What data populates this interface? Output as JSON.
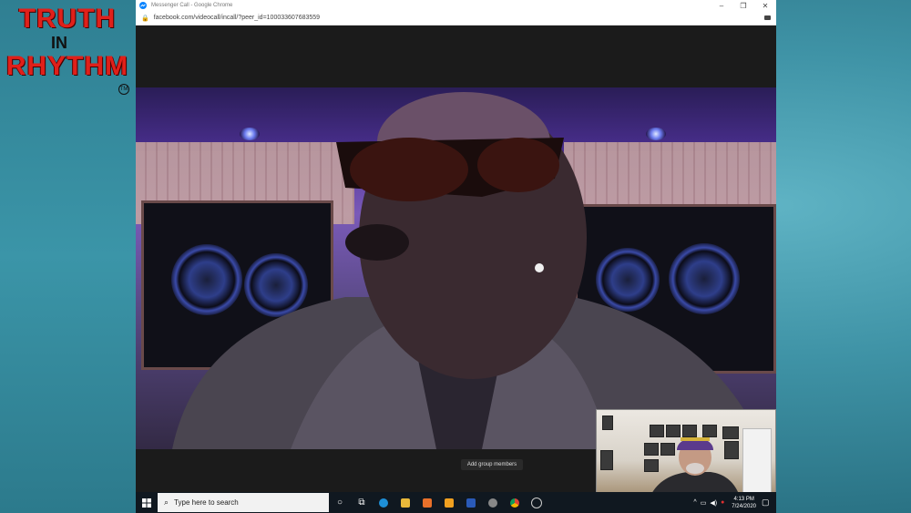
{
  "overlay": {
    "logo_line1": "TRUTH",
    "logo_line2": "IN",
    "logo_line3": "RHYTHM",
    "logo_mark": "TM"
  },
  "browser": {
    "window_title": "Messenger Call - Google Chrome",
    "url": "facebook.com/videocall/incall/?peer_id=100033607683559",
    "controls": [
      "minimize",
      "restore",
      "close"
    ]
  },
  "call": {
    "add_members_tooltip": "Add group members"
  },
  "taskbar": {
    "search_placeholder": "Type here to search",
    "time": "4:13 PM",
    "date": "7/24/2020",
    "apps": [
      "task-view",
      "edge",
      "file-explorer",
      "media",
      "outlook",
      "word",
      "app",
      "chrome",
      "app2"
    ]
  },
  "colors": {
    "accent_red": "#e0201a",
    "desktop_teal": "#3f93a6",
    "taskbar": "#101820"
  }
}
